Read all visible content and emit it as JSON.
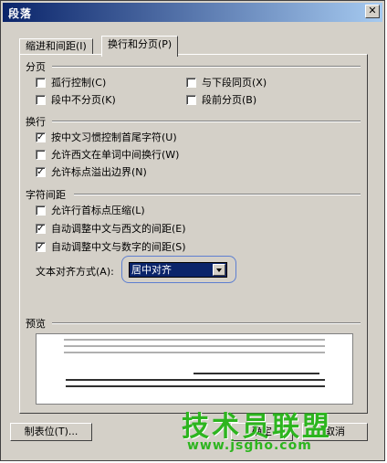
{
  "window": {
    "title": "段落",
    "close_glyph": "✕"
  },
  "tabs": [
    {
      "label": "缩进和间距(I)",
      "active": false
    },
    {
      "label": "换行和分页(P)",
      "active": true
    }
  ],
  "pagination": {
    "title": "分页",
    "items": [
      {
        "label": "孤行控制(C)",
        "checked": false
      },
      {
        "label": "与下段同页(X)",
        "checked": false
      },
      {
        "label": "段中不分页(K)",
        "checked": false
      },
      {
        "label": "段前分页(B)",
        "checked": false
      }
    ]
  },
  "line_break": {
    "title": "换行",
    "items": [
      {
        "label": "按中文习惯控制首尾字符(U)",
        "checked": true
      },
      {
        "label": "允许西文在单词中间换行(W)",
        "checked": false
      },
      {
        "label": "允许标点溢出边界(N)",
        "checked": true
      }
    ]
  },
  "char_spacing": {
    "title": "字符间距",
    "items": [
      {
        "label": "允许行首标点压缩(L)",
        "checked": false
      },
      {
        "label": "自动调整中文与西文的间距(E)",
        "checked": true
      },
      {
        "label": "自动调整中文与数字的间距(S)",
        "checked": true
      }
    ],
    "align_label": "文本对齐方式(A):",
    "align_value": "居中对齐"
  },
  "preview": {
    "title": "预览"
  },
  "buttons": {
    "tabs_label": "制表位(T)...",
    "ok_label": "确定",
    "cancel_label": "取消"
  },
  "watermark": {
    "big": "技术员联盟",
    "small": "www.jsgho.com"
  },
  "colors": {
    "title_start": "#0a246a",
    "title_end": "#a6caf0",
    "watermark": "#2db51f",
    "select_bg": "#0a246a"
  }
}
